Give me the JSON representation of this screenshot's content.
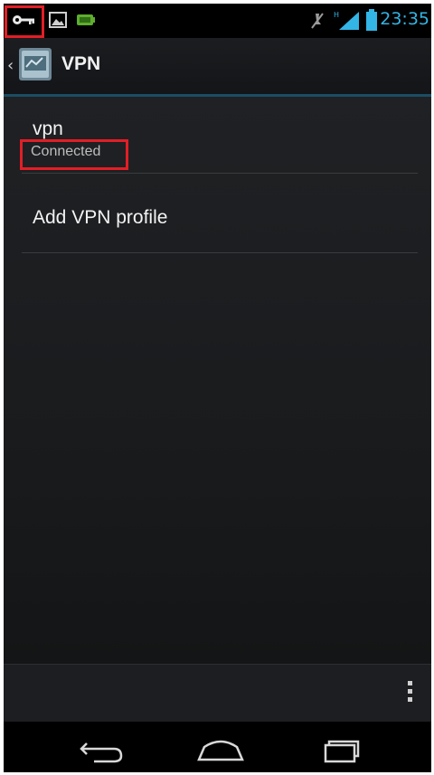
{
  "status_bar": {
    "time": "23:35",
    "icons": [
      "vpn-key-icon",
      "image-notification-icon",
      "battery-notification-icon",
      "mute-icon",
      "signal-icon",
      "battery-icon"
    ],
    "accent_color": "#33b5e5",
    "highlight_color": "#e21e26"
  },
  "action_bar": {
    "title": "VPN",
    "icon": "vpn-settings-icon"
  },
  "list": {
    "items": [
      {
        "title": "vpn",
        "summary": "Connected"
      },
      {
        "title": "Add VPN profile"
      }
    ]
  },
  "menu_bar": {
    "icons": [
      "overflow-menu-icon"
    ]
  },
  "nav_bar": {
    "icons": [
      "back-icon",
      "home-icon",
      "recent-apps-icon"
    ]
  }
}
